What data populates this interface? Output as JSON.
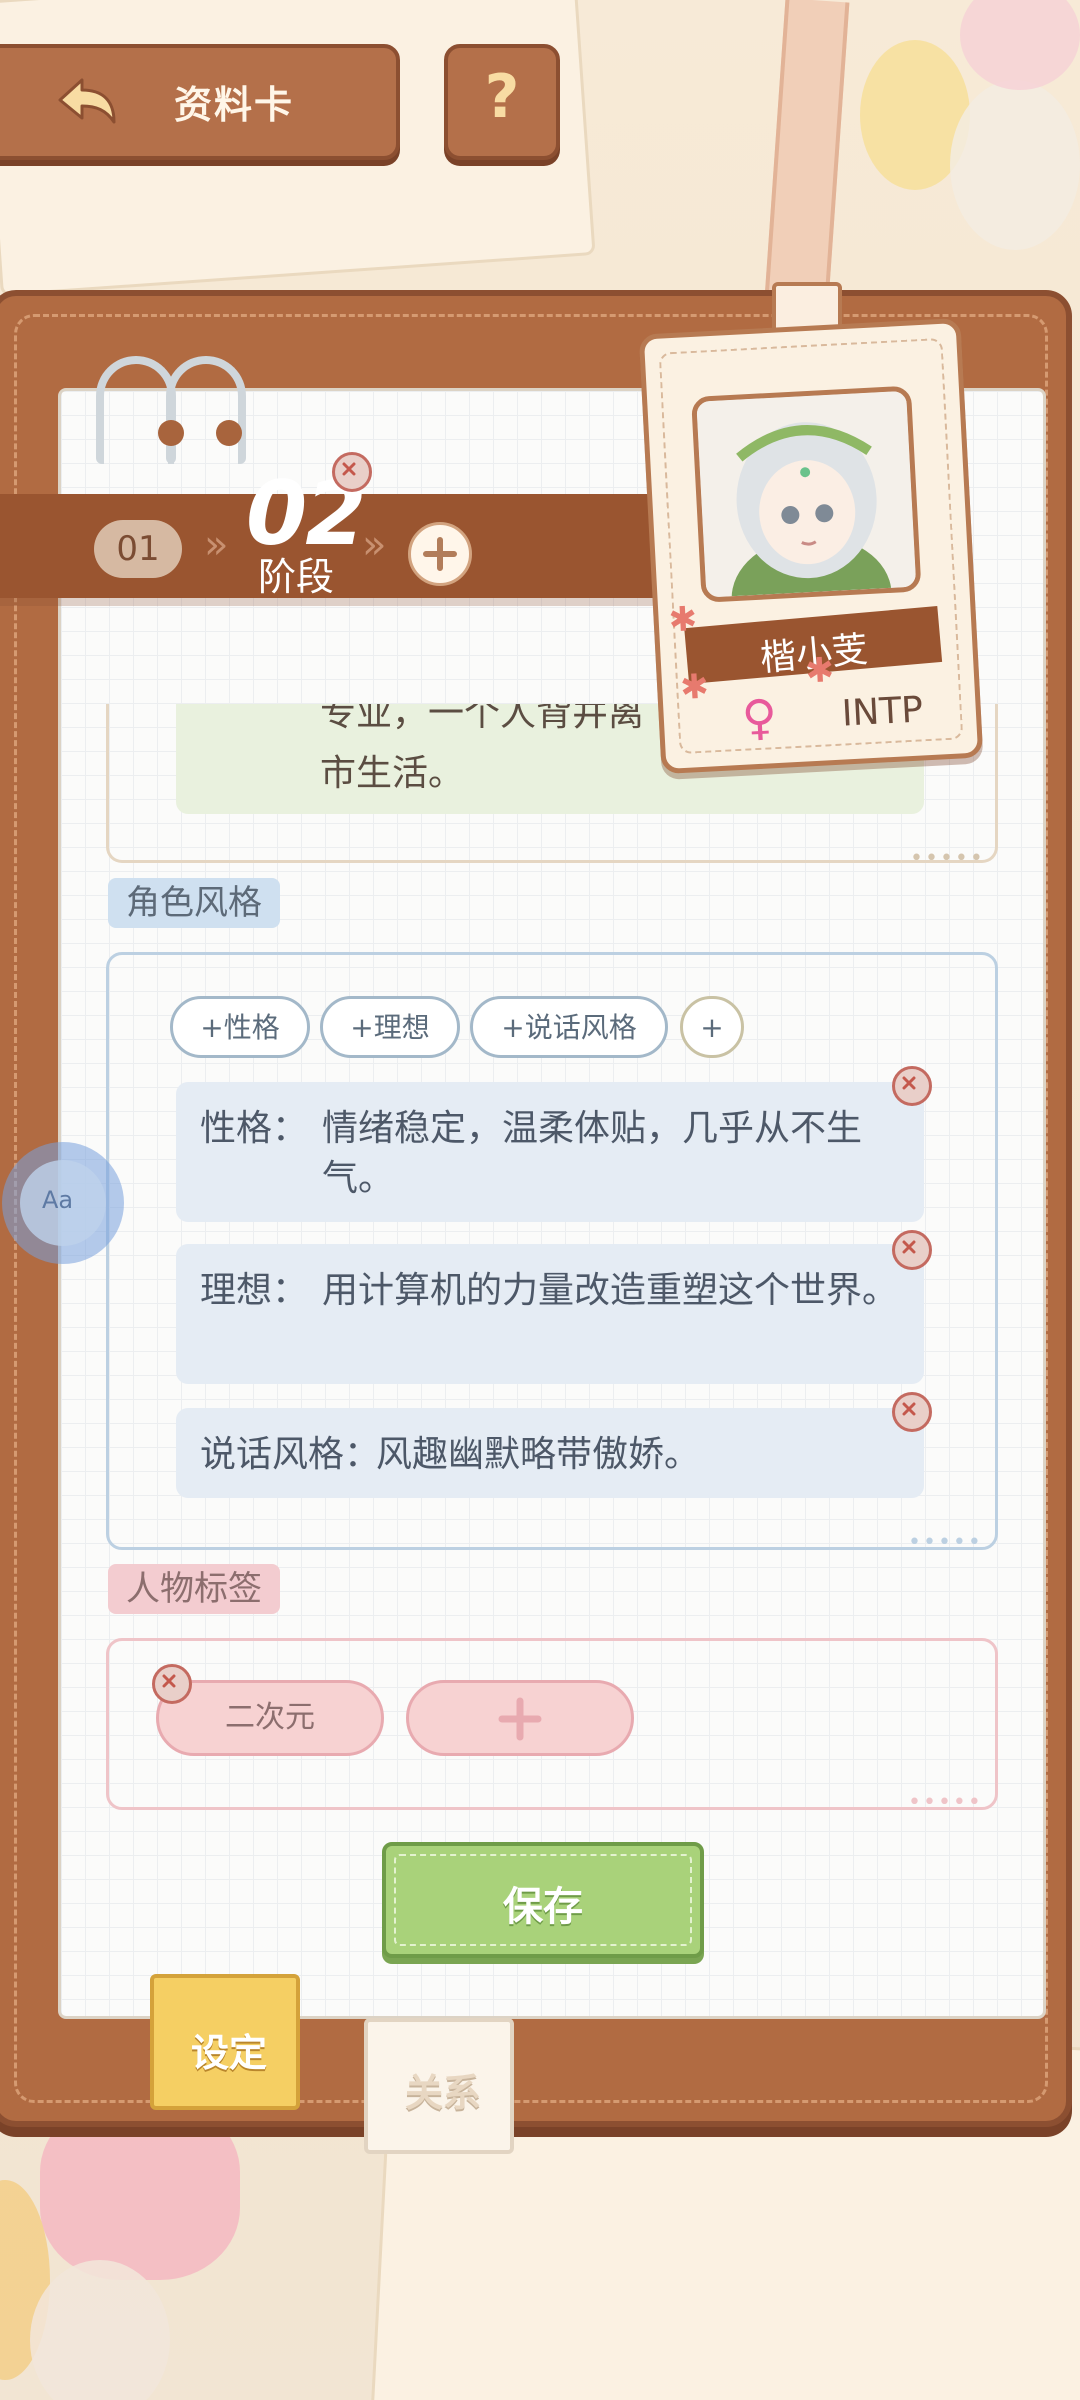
{
  "header": {
    "back_label": "资料卡",
    "help_label": "?"
  },
  "stage": {
    "prev": "01",
    "current_number": "02",
    "current_word": "阶段",
    "chevron": "»"
  },
  "character": {
    "name": "楷小芰",
    "gender_symbol": "♀",
    "mbti": "INTP"
  },
  "intro": {
    "cut_line": "专业，一个人背井离",
    "line2": "市生活。"
  },
  "style_section": {
    "title": "角色风格",
    "chips": [
      "+性格",
      "+理想",
      "+说话风格",
      "+"
    ],
    "traits": [
      {
        "key": "性格：",
        "value": "情绪稳定，温柔体贴，几乎从不生气。"
      },
      {
        "key": "理想：",
        "value": "用计算机的力量改造重塑这个世界。"
      },
      {
        "key": "说话风格：",
        "value": "风趣幽默略带傲娇。"
      }
    ]
  },
  "tags_section": {
    "title": "人物标签",
    "tags": [
      "二次元"
    ]
  },
  "save_label": "保存",
  "tabs": [
    {
      "label": "设定"
    },
    {
      "label": "关系"
    }
  ],
  "float_button_label": "Aa",
  "colors": {
    "board": "#b16b42",
    "save_green": "#a9d27a",
    "tab_active": "#f5cf63",
    "style_blue": "#a3b8c9",
    "tag_pink": "#f7d2d2"
  }
}
